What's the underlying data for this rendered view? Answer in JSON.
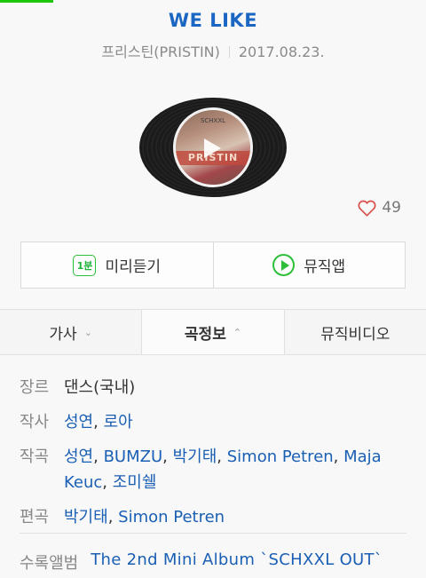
{
  "song": {
    "title": "WE LIKE",
    "artist": "프리스틴(PRISTIN)",
    "release_date": "2017.08.23."
  },
  "album_art": {
    "cover_text": "PRISTIN",
    "cover_small_text": "SCHXXL",
    "state": "paused"
  },
  "likes": {
    "count": "49",
    "icon": "heart-outline-icon"
  },
  "actions": {
    "preview_badge": "1분",
    "preview_label": "미리듣기",
    "musicapp_label": "뮤직앱"
  },
  "tabs": [
    {
      "label": "가사",
      "chevron": "⌄"
    },
    {
      "label": "곡정보",
      "chevron": "⌃",
      "active": true
    },
    {
      "label": "뮤직비디오"
    }
  ],
  "info": {
    "genre_label": "장르",
    "genre": "댄스(국내)",
    "lyricist_label": "작사",
    "lyricists": [
      "성연",
      "로아"
    ],
    "composer_label": "작곡",
    "composers": [
      "성연",
      "BUMZU",
      "박기태",
      "Simon Petren",
      "Maja Keuc",
      "조미쉘"
    ],
    "arranger_label": "편곡",
    "arrangers": [
      "박기태",
      "Simon Petren"
    ],
    "album_label": "수록앨범",
    "album": "The 2nd Mini Album `SCHXXL OUT`"
  },
  "colors": {
    "accent_green": "#1fc70b",
    "link_blue": "#1a5fb4",
    "title_blue": "#1a66c2"
  }
}
